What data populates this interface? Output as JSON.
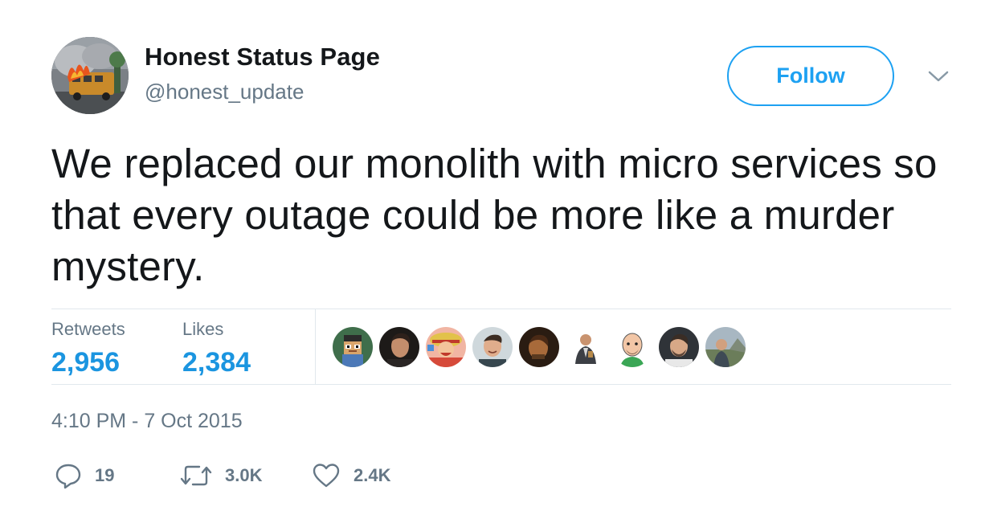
{
  "user": {
    "display_name": "Honest Status Page",
    "handle": "@honest_update",
    "avatar_icon": "burning-bus-avatar"
  },
  "follow_button": {
    "label": "Follow"
  },
  "menu": {
    "icon": "chevron-down-icon"
  },
  "tweet": {
    "text": "We replaced our monolith with micro services so that every outage could be more like a murder mystery.",
    "timestamp": "4:10 PM - 7 Oct 2015"
  },
  "stats": {
    "retweets_label": "Retweets",
    "retweets_value": "2,956",
    "likes_label": "Likes",
    "likes_value": "2,384"
  },
  "likers": [
    {
      "icon": "pixel-art-avatar"
    },
    {
      "icon": "man-portrait-avatar"
    },
    {
      "icon": "anime-character-avatar"
    },
    {
      "icon": "smiling-man-avatar"
    },
    {
      "icon": "dark-portrait-avatar"
    },
    {
      "icon": "man-jacket-avatar"
    },
    {
      "icon": "cartoon-bald-man-avatar"
    },
    {
      "icon": "bearded-man-avatar"
    },
    {
      "icon": "outdoor-man-avatar"
    }
  ],
  "actions": {
    "reply_icon": "reply-icon",
    "reply_count": "19",
    "retweet_icon": "retweet-icon",
    "retweet_count": "3.0K",
    "like_icon": "heart-icon",
    "like_count": "2.4K"
  },
  "colors": {
    "accent": "#1da1f2",
    "stat_value": "#1b95e0",
    "muted": "#657786",
    "text": "#14171a",
    "divider": "#e1e8ed"
  }
}
